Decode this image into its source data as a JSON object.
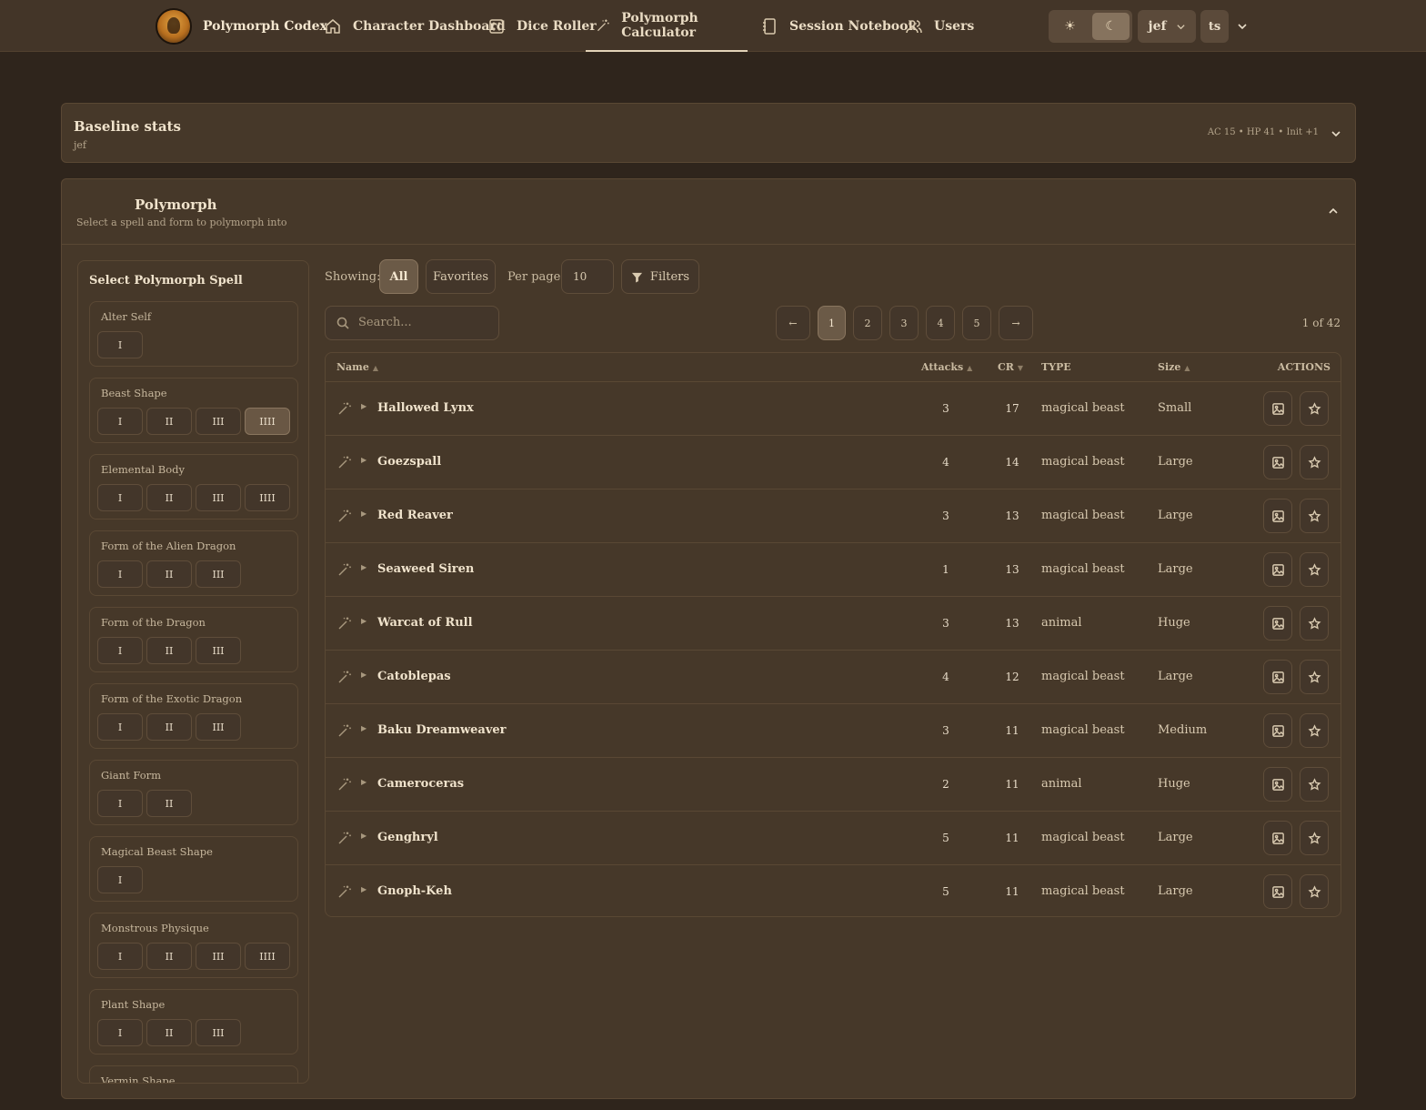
{
  "nav": {
    "brand": "Polymorph Codex",
    "items": [
      {
        "label": "Character Dashboard",
        "icon": "home-icon"
      },
      {
        "label": "Dice Roller",
        "icon": "dice-icon"
      },
      {
        "label": "Polymorph Calculator",
        "icon": "wand-icon",
        "active": true
      },
      {
        "label": "Session Notebook",
        "icon": "notebook-icon"
      },
      {
        "label": "Users",
        "icon": "users-icon"
      }
    ],
    "theme": {
      "light": "☀",
      "dark": "☾",
      "selected": "dark"
    },
    "user": "jef",
    "ts_label": "ts"
  },
  "baseline": {
    "title": "Baseline stats",
    "subtitle": "jef",
    "summary": "AC 15 • HP 41 • Init +1"
  },
  "polymorph": {
    "title": "Polymorph",
    "subtitle": "Select a spell and form to polymorph into",
    "spell_panel_title": "Select Polymorph Spell",
    "spells": [
      {
        "name": "Alter Self",
        "levels": [
          "I"
        ]
      },
      {
        "name": "Beast Shape",
        "levels": [
          "I",
          "II",
          "III",
          "IIII"
        ],
        "selected": "IIII"
      },
      {
        "name": "Elemental Body",
        "levels": [
          "I",
          "II",
          "III",
          "IIII"
        ]
      },
      {
        "name": "Form of the Alien Dragon",
        "levels": [
          "I",
          "II",
          "III"
        ]
      },
      {
        "name": "Form of the Dragon",
        "levels": [
          "I",
          "II",
          "III"
        ]
      },
      {
        "name": "Form of the Exotic Dragon",
        "levels": [
          "I",
          "II",
          "III"
        ]
      },
      {
        "name": "Giant Form",
        "levels": [
          "I",
          "II"
        ]
      },
      {
        "name": "Magical Beast Shape",
        "levels": [
          "I"
        ]
      },
      {
        "name": "Monstrous Physique",
        "levels": [
          "I",
          "II",
          "III",
          "IIII"
        ]
      },
      {
        "name": "Plant Shape",
        "levels": [
          "I",
          "II",
          "III"
        ]
      },
      {
        "name": "Vermin Shape",
        "levels": []
      }
    ],
    "toolbar": {
      "showing_label": "Showing:",
      "all_label": "All",
      "favorites_label": "Favorites",
      "per_page_label": "Per page:",
      "per_page_value": "10",
      "filters_label": "Filters",
      "search_placeholder": "Search...",
      "prev": "←",
      "next": "→",
      "pages": [
        "1",
        "2",
        "3",
        "4",
        "5"
      ],
      "current_page": "1",
      "page_count": "1 of 42"
    },
    "table": {
      "headers": {
        "name": "Name",
        "attacks": "Attacks",
        "cr": "CR",
        "type": "TYPE",
        "size": "Size",
        "actions": "ACTIONS"
      },
      "rows": [
        {
          "name": "Hallowed Lynx",
          "attacks": "3",
          "cr": "17",
          "type": "magical beast",
          "size": "Small"
        },
        {
          "name": "Goezspall",
          "attacks": "4",
          "cr": "14",
          "type": "magical beast",
          "size": "Large"
        },
        {
          "name": "Red Reaver",
          "attacks": "3",
          "cr": "13",
          "type": "magical beast",
          "size": "Large"
        },
        {
          "name": "Seaweed Siren",
          "attacks": "1",
          "cr": "13",
          "type": "magical beast",
          "size": "Large"
        },
        {
          "name": "Warcat of Rull",
          "attacks": "3",
          "cr": "13",
          "type": "animal",
          "size": "Huge"
        },
        {
          "name": "Catoblepas",
          "attacks": "4",
          "cr": "12",
          "type": "magical beast",
          "size": "Large"
        },
        {
          "name": "Baku Dreamweaver",
          "attacks": "3",
          "cr": "11",
          "type": "magical beast",
          "size": "Medium"
        },
        {
          "name": "Cameroceras",
          "attacks": "2",
          "cr": "11",
          "type": "animal",
          "size": "Huge"
        },
        {
          "name": "Genghryl",
          "attacks": "5",
          "cr": "11",
          "type": "magical beast",
          "size": "Large"
        },
        {
          "name": "Gnoph-Keh",
          "attacks": "5",
          "cr": "11",
          "type": "magical beast",
          "size": "Large"
        }
      ]
    }
  }
}
